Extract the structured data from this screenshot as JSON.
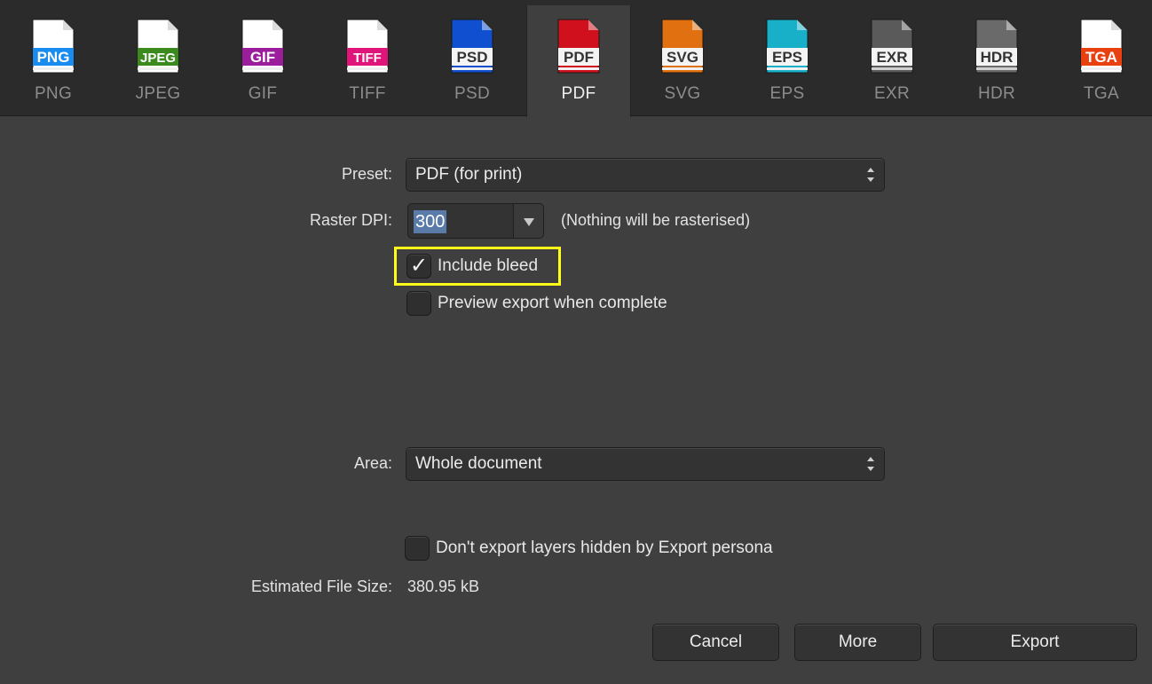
{
  "formats": [
    {
      "tag": "PNG",
      "label": "PNG",
      "color": "#1a8cf0"
    },
    {
      "tag": "JPEG",
      "label": "JPEG",
      "color": "#3a8a1e"
    },
    {
      "tag": "GIF",
      "label": "GIF",
      "color": "#9b1d9b"
    },
    {
      "tag": "TIFF",
      "label": "TIFF",
      "color": "#e0157a"
    },
    {
      "tag": "PSD",
      "label": "PSD",
      "color": "#1050d0"
    },
    {
      "tag": "PDF",
      "label": "PDF",
      "color": "#d0101c"
    },
    {
      "tag": "SVG",
      "label": "SVG",
      "color": "#e07010"
    },
    {
      "tag": "EPS",
      "label": "EPS",
      "color": "#18b0c8"
    },
    {
      "tag": "EXR",
      "label": "EXR",
      "color": "#5a5a5a"
    },
    {
      "tag": "HDR",
      "label": "HDR",
      "color": "#6a6a6a"
    },
    {
      "tag": "TGA",
      "label": "TGA",
      "color": "#e84010"
    }
  ],
  "selected_format": "PDF",
  "preset": {
    "label": "Preset:",
    "value": "PDF (for print)"
  },
  "raster_dpi": {
    "label": "Raster DPI:",
    "value": "300",
    "note": "(Nothing will be rasterised)"
  },
  "include_bleed": {
    "label": "Include bleed",
    "checked": true,
    "highlight_color": "#ffff1a"
  },
  "preview_export": {
    "label": "Preview export when complete",
    "checked": false
  },
  "area": {
    "label": "Area:",
    "value": "Whole document"
  },
  "dont_export_hidden": {
    "label": "Don't export layers hidden by Export persona",
    "checked": false
  },
  "file_size": {
    "label": "Estimated File Size:",
    "value": "380.95 kB"
  },
  "buttons": {
    "cancel": "Cancel",
    "more": "More",
    "export": "Export"
  }
}
